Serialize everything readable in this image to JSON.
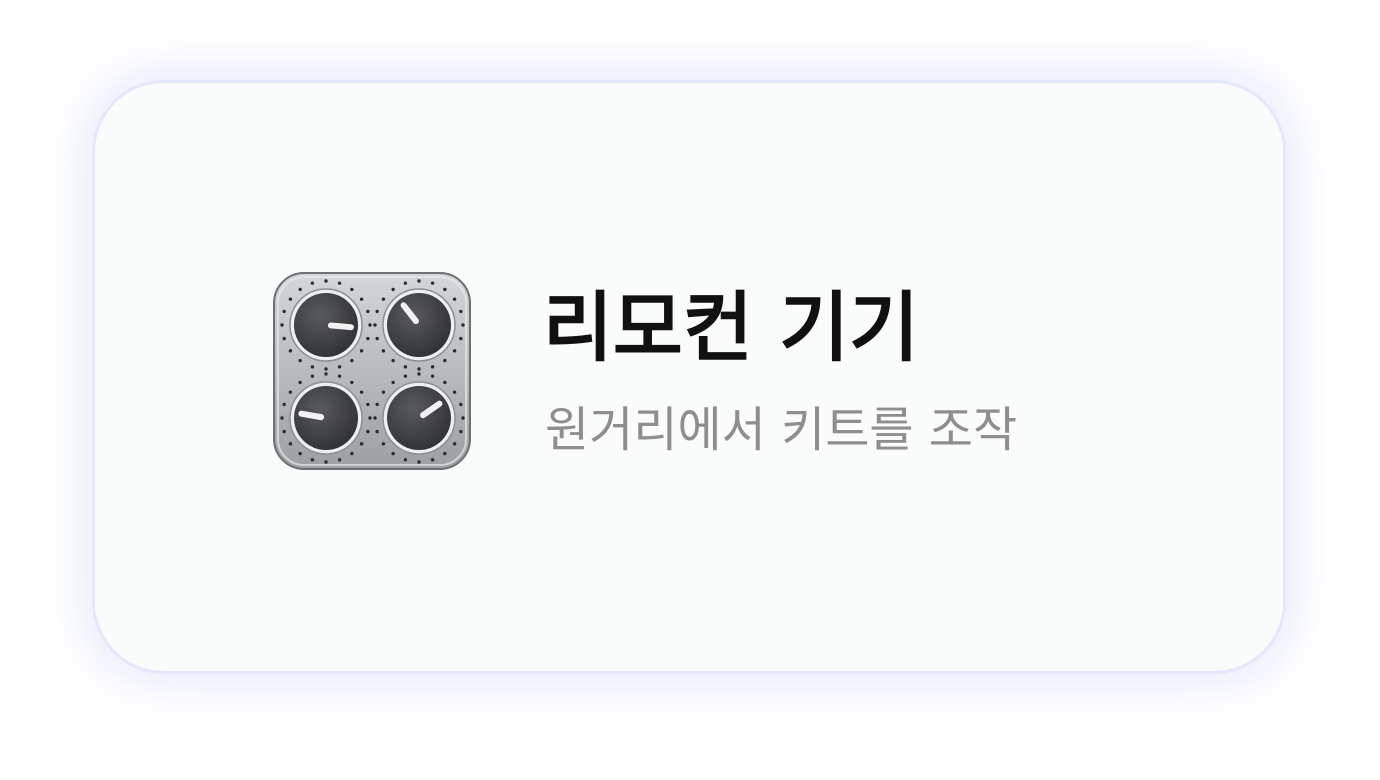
{
  "widget": {
    "title": "리모컨 기기",
    "subtitle": "원거리에서 키트를 조작",
    "icon": "control-knobs-icon",
    "colors": {
      "card_background": "#fafbfb",
      "card_border": "#e3e7fb",
      "title": "#111111",
      "subtitle": "#8e8e8e",
      "icon_panel": "#b8babd",
      "knob": "#3f4044"
    }
  }
}
